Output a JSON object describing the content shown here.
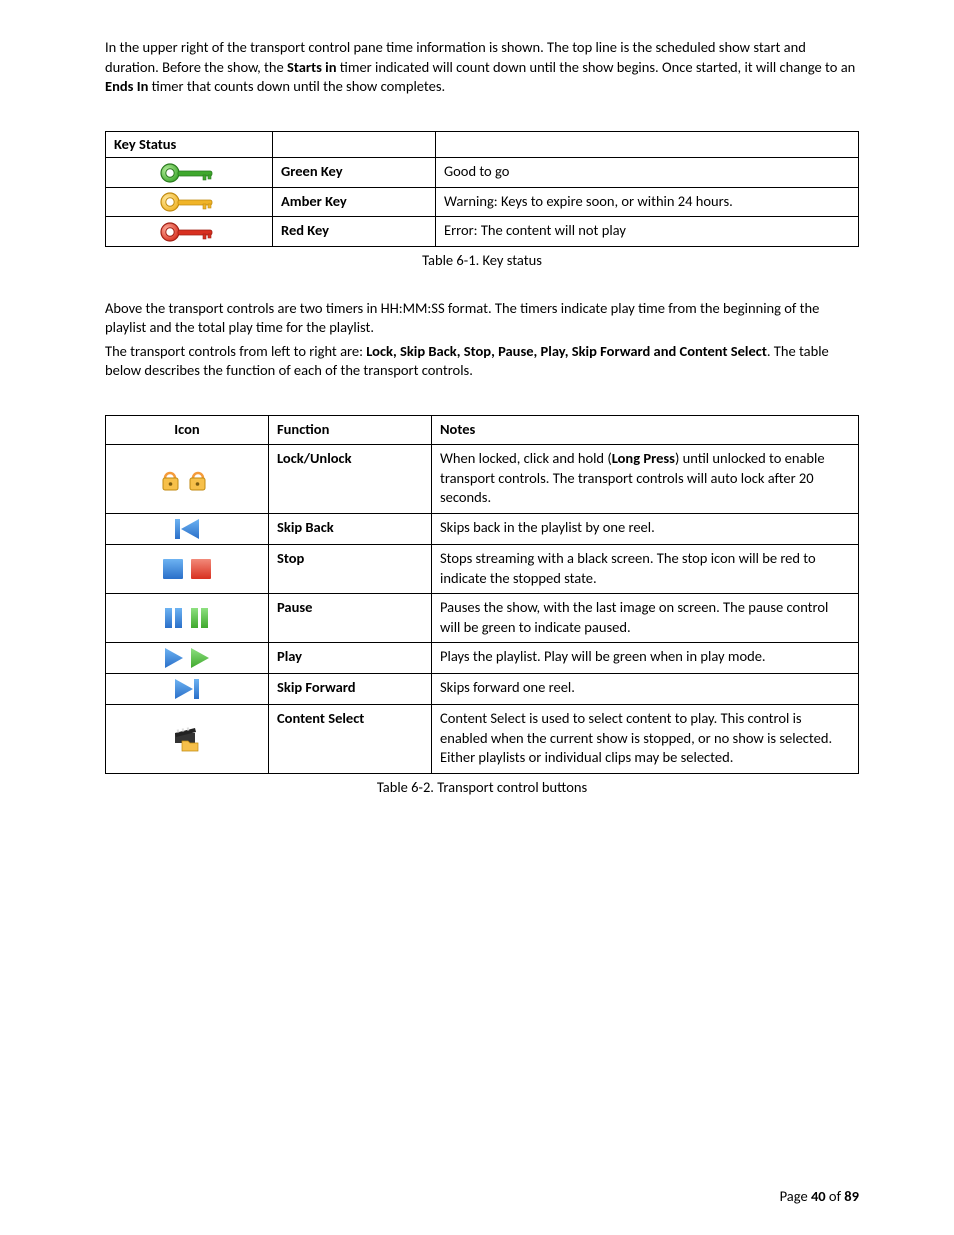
{
  "intro": {
    "p1a": "In the upper right of the transport control pane time information is shown.  The top line is the scheduled show start and duration. Before the show, the ",
    "p1b": "Starts in",
    "p1c": " timer indicated will count down until the show begins.  Once started, it will change to an ",
    "p1d": "Ends In",
    "p1e": " timer that counts down until the show completes."
  },
  "table1": {
    "header": "Key Status",
    "rows": [
      {
        "name": "Green Key",
        "desc": "Good to go"
      },
      {
        "name": "Amber Key",
        "desc": "Warning: Keys to expire soon, or within 24 hours."
      },
      {
        "name": "Red Key",
        "desc": "Error: The content will not play"
      }
    ],
    "caption": "Table 6-1.  Key status"
  },
  "mid": {
    "p1": "Above the transport controls are two timers in HH:MM:SS format.  The timers indicate play time from the beginning of the playlist and the total play time for the playlist.",
    "p2a": "The transport controls from left to right are:  ",
    "p2b": "Lock, Skip Back, Stop, Pause, Play, Skip Forward and Content Select",
    "p2c": ".  The table below describes the function of each of the transport controls."
  },
  "table2": {
    "headers": {
      "icon": "Icon",
      "func": "Function",
      "notes": "Notes"
    },
    "rows": [
      {
        "func": "Lock/Unlock",
        "notes_a": "When locked, click and hold (",
        "notes_b": "Long Press",
        "notes_c": ") until unlocked to enable transport controls.  The transport controls will auto lock after 20 seconds."
      },
      {
        "func": "Skip Back",
        "notes": "Skips back in the playlist by one reel."
      },
      {
        "func": "Stop",
        "notes": "Stops streaming with a black screen.  The stop icon will be red to indicate the stopped state."
      },
      {
        "func": "Pause",
        "notes": "Pauses the show, with the last image on screen.  The pause control will be green to indicate paused."
      },
      {
        "func": "Play",
        "notes": "Plays the playlist.  Play will be green when in play mode."
      },
      {
        "func": "Skip Forward",
        "notes": "Skips forward one reel."
      },
      {
        "func": "Content Select",
        "notes": "Content Select is used to select content to play.  This control is enabled when the current show is stopped, or no show is selected.  Either playlists or individual clips may be selected."
      }
    ],
    "caption": "Table 6-2.  Transport control buttons"
  },
  "footer": {
    "a": "Page ",
    "b": "40",
    "c": " of ",
    "d": "89"
  }
}
